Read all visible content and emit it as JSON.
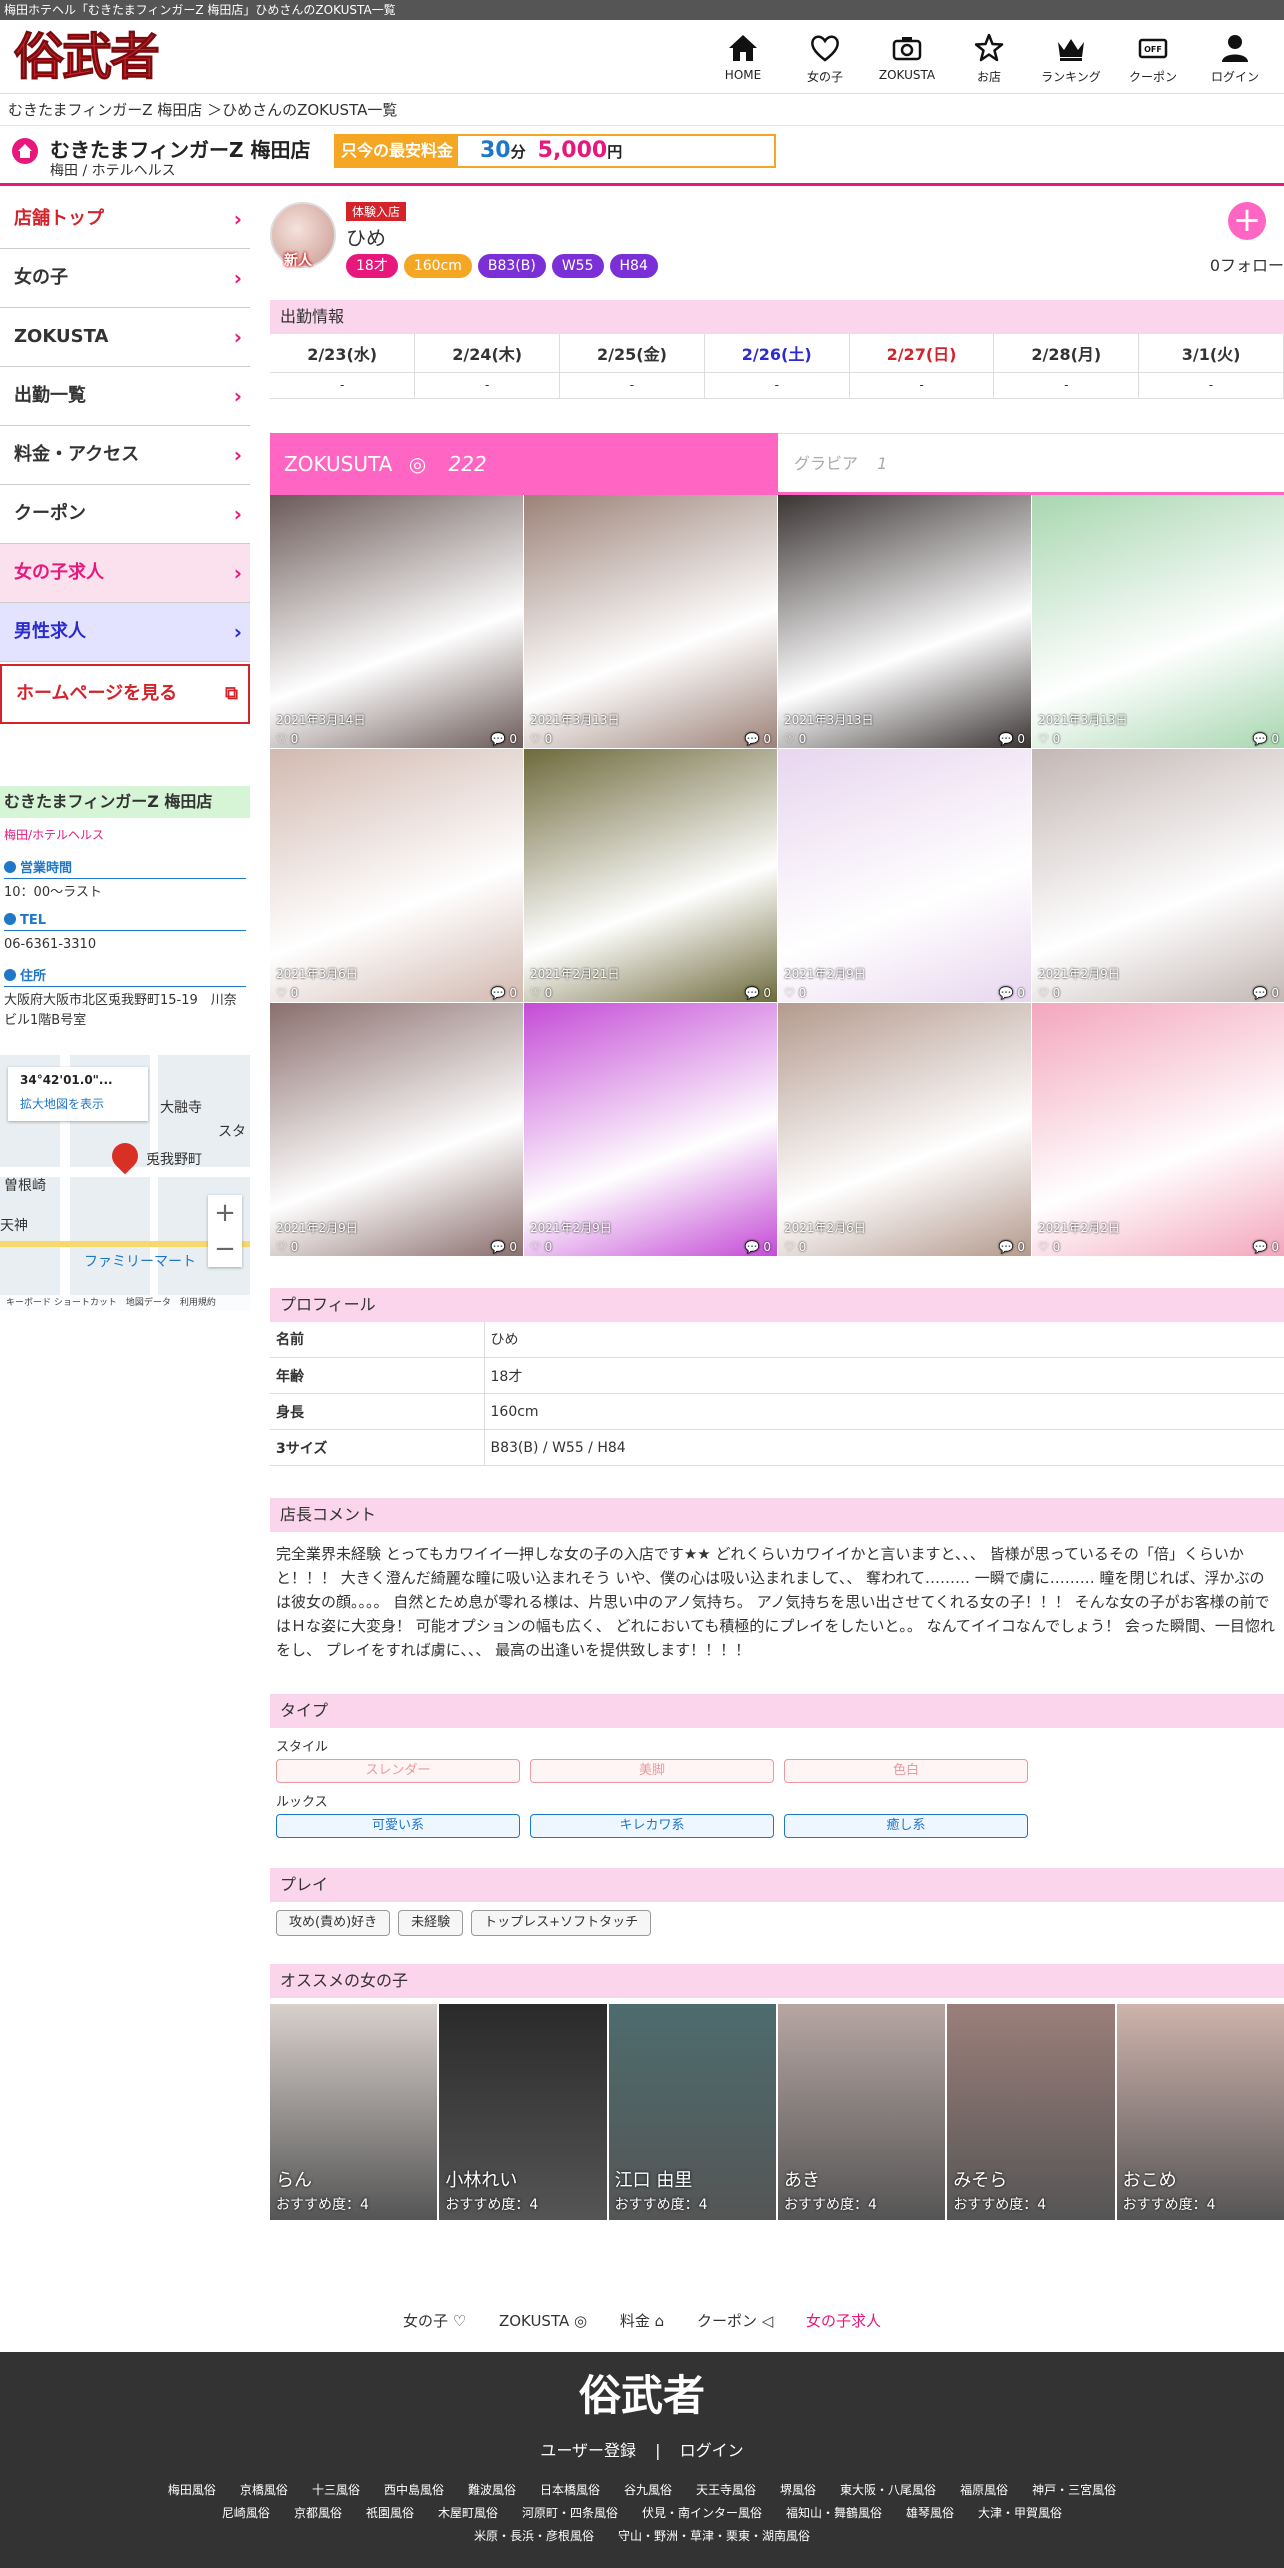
{
  "topbar": "梅田ホテヘル「むきたまフィンガーZ 梅田店」ひめさんのZOKUSTA一覧",
  "logo": "俗武者",
  "nav": [
    {
      "label": "HOME",
      "icon": "home-icon"
    },
    {
      "label": "女の子",
      "icon": "heart-icon"
    },
    {
      "label": "ZOKUSTA",
      "icon": "camera-icon"
    },
    {
      "label": "お店",
      "icon": "star-icon"
    },
    {
      "label": "ランキング",
      "icon": "crown-icon"
    },
    {
      "label": "クーポン",
      "icon": "coupon-icon"
    },
    {
      "label": "ログイン",
      "icon": "user-icon"
    }
  ],
  "breadcrumb": "むきたまフィンガーZ 梅田店 ＞ひめさんのZOKUSTA一覧",
  "shop": {
    "name": "むきたまフィンガーZ 梅田店",
    "category": "梅田 / ホテルヘルス",
    "price_label": "只今の最安料金",
    "price_min": "30",
    "price_min_unit": "分",
    "price_yen": "5,000",
    "price_yen_unit": "円"
  },
  "sidebar": {
    "items": [
      {
        "label": "店舗トップ"
      },
      {
        "label": "女の子"
      },
      {
        "label": "ZOKUSTA"
      },
      {
        "label": "出勤一覧"
      },
      {
        "label": "料金・アクセス"
      },
      {
        "label": "クーポン"
      },
      {
        "label": "女の子求人"
      },
      {
        "label": "男性求人"
      }
    ],
    "homepage": "ホームページを見る"
  },
  "shopbox": {
    "title": "むきたまフィンガーZ 梅田店",
    "category": "梅田/ホテルヘルス",
    "hours_label": "営業時間",
    "hours": "10：00～ラスト",
    "tel_label": "TEL",
    "tel": "06-6361-3310",
    "addr_label": "住所",
    "addr": "大阪府大阪市北区兎我野町15-19　川奈ビル1階B号室"
  },
  "map": {
    "coord": "34°42'01.0\"...",
    "bigmap": "拡大地図を表示",
    "labels": [
      "兎我野町",
      "曽根崎",
      "ファミリーマート",
      "大融寺",
      "天神",
      "スタ"
    ],
    "footer": "キーボード ショートカット　地図データ　利用規約"
  },
  "girl": {
    "badge": "体験入店",
    "new_mark": "新人",
    "name": "ひめ",
    "age": "18才",
    "height": "160cm",
    "bust": "B83(B)",
    "waist": "W55",
    "hip": "H84",
    "follow_count": "0フォロー"
  },
  "schedule": {
    "title": "出勤情報",
    "days": [
      "2/23(水)",
      "2/24(木)",
      "2/25(金)",
      "2/26(土)",
      "2/27(日)",
      "2/28(月)",
      "3/1(火)"
    ],
    "values": [
      "-",
      "-",
      "-",
      "-",
      "-",
      "-",
      "-"
    ]
  },
  "tabs": {
    "zokusta": "ZOKUSUTA",
    "zokusta_count": "222",
    "gravure": "グラビア",
    "gravure_count": "1"
  },
  "posts": [
    {
      "date": "2021年3月14日",
      "likes": "0",
      "comments": "0",
      "bg": "#6b5a58"
    },
    {
      "date": "2021年3月13日",
      "likes": "0",
      "comments": "0",
      "bg": "#9c8278"
    },
    {
      "date": "2021年3月13日",
      "likes": "0",
      "comments": "0",
      "bg": "#3a3433"
    },
    {
      "date": "2021年3月13日",
      "likes": "0",
      "comments": "0",
      "bg": "#a8d6b0"
    },
    {
      "date": "2021年3月6日",
      "likes": "0",
      "comments": "0",
      "bg": "#d2b9b0"
    },
    {
      "date": "2021年2月21日",
      "likes": "0",
      "comments": "0",
      "bg": "#6e6a3c"
    },
    {
      "date": "2021年2月9日",
      "likes": "0",
      "comments": "0",
      "bg": "#e8d6ef"
    },
    {
      "date": "2021年2月9日",
      "likes": "0",
      "comments": "0",
      "bg": "#c3b7b4"
    },
    {
      "date": "2021年2月9日",
      "likes": "0",
      "comments": "0",
      "bg": "#8a6f6d"
    },
    {
      "date": "2021年2月9日",
      "likes": "0",
      "comments": "0",
      "bg": "#c44bd6"
    },
    {
      "date": "2021年2月6日",
      "likes": "0",
      "comments": "0",
      "bg": "#b49a8e"
    },
    {
      "date": "2021年2月2日",
      "likes": "0",
      "comments": "0",
      "bg": "#f3a6bd"
    }
  ],
  "profile": {
    "title": "プロフィール",
    "rows": [
      {
        "k": "名前",
        "v": "ひめ"
      },
      {
        "k": "年齢",
        "v": "18才"
      },
      {
        "k": "身長",
        "v": "160cm"
      },
      {
        "k": "3サイズ",
        "v": "B83(B) / W55 / H84"
      }
    ]
  },
  "comment": {
    "title": "店長コメント",
    "text": "完全業界未経験 とってもカワイイ一押しな女の子の入店です★★ どれくらいカワイイかと言いますと、、、 皆様が思っているその「倍」くらいかと！！！ 大きく澄んだ綺麗な瞳に吸い込まれそう いや、僕の心は吸い込まれまして、、 奪われて……… 一瞬で虜に……… 瞳を閉じれば、浮かぶのは彼女の顔。。。。 自然とため息が零れる様は、片思い中のアノ気持ち。 アノ気持ちを思い出させてくれる女の子！！！ そんな女の子がお客様の前ではＨな姿に大変身！ 可能オプションの幅も広く、 どれにおいても積極的にプレイをしたいと。。 なんてイイコなんでしょう！ 会った瞬間、一目惚れをし、 プレイをすれば虜に、、、 最高の出逢いを提供致します！！！！"
  },
  "type": {
    "title": "タイプ",
    "style_label": "スタイル",
    "styles": [
      "スレンダー",
      "美脚",
      "色白"
    ],
    "looks_label": "ルックス",
    "looks": [
      "可愛い系",
      "キレカワ系",
      "癒し系"
    ]
  },
  "play": {
    "title": "プレイ",
    "items": [
      "攻め(責め)好き",
      "未経験",
      "トップレス+ソフトタッチ"
    ]
  },
  "recommend": {
    "title": "オススメの女の子",
    "items": [
      {
        "name": "らん",
        "score": "おすすめ度：4",
        "bg": "#d8d0cc"
      },
      {
        "name": "小林れい",
        "score": "おすすめ度：4",
        "bg": "#2a2a2a"
      },
      {
        "name": "江口 由里",
        "score": "おすすめ度：4",
        "bg": "#4d6c6e"
      },
      {
        "name": "あき",
        "score": "おすすめ度：4",
        "bg": "#b6a6a2"
      },
      {
        "name": "みそら",
        "score": "おすすめ度：4",
        "bg": "#9c7f7a"
      },
      {
        "name": "おこめ",
        "score": "おすすめ度：4",
        "bg": "#cfb3ac"
      }
    ]
  },
  "footnav": [
    "女の子 ♡",
    "ZOKUSTA ◎",
    "料金 ⌂",
    "クーポン ◁",
    "女の子求人"
  ],
  "footer": {
    "logo": "俗武者",
    "register": "ユーザー登録",
    "login": "ログイン",
    "areas": [
      "梅田風俗",
      "京橋風俗",
      "十三風俗",
      "西中島風俗",
      "難波風俗",
      "日本橋風俗",
      "谷九風俗",
      "天王寺風俗",
      "堺風俗",
      "東大阪・八尾風俗",
      "福原風俗",
      "神戸・三宮風俗",
      "尼崎風俗",
      "京都風俗",
      "祇園風俗",
      "木屋町風俗",
      "河原町・四条風俗",
      "伏見・南インター風俗",
      "福知山・舞鶴風俗",
      "雄琴風俗",
      "大津・甲賀風俗",
      "米原・長浜・彦根風俗",
      "守山・野洲・草津・栗東・湖南風俗"
    ]
  },
  "colors": {
    "accent": "#e8177b",
    "brand_red": "#d4232b",
    "price_orange": "#f5a623",
    "section_pink": "#fbd5ec"
  }
}
